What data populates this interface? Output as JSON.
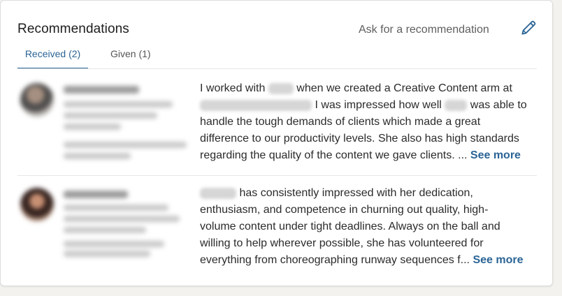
{
  "section": {
    "title": "Recommendations",
    "ask_link": "Ask for a recommendation",
    "edit_icon": "pencil-icon"
  },
  "tabs": [
    {
      "label": "Received (2)",
      "selected": true
    },
    {
      "label": "Given (1)",
      "selected": false
    }
  ],
  "recommendations": [
    {
      "text": {
        "l1a": "I worked with",
        "l1b": "when we created a Creative Content arm at",
        "l2a": "I was impressed how well",
        "l2b": "was able to",
        "l3": "handle the tough demands of clients which made a great",
        "l4": "difference to our productivity levels. She also has high standards",
        "l5": "regarding the quality of the content we gave clients. ...",
        "see_more": "See more"
      }
    },
    {
      "text": {
        "l1": "has consistently impressed with her dedication,",
        "l2": "enthusiasm, and competence in churning out quality, high-",
        "l3": "volume content under tight deadlines. Always on the ball and",
        "l4": "willing to help wherever possible, she has volunteered for",
        "l5": "everything from choreographing runway sequences f...",
        "see_more": "See more"
      }
    }
  ],
  "colors": {
    "accent": "#2a6496",
    "text": "#2b2b2b",
    "muted": "#5e5e5e",
    "background": "#f3f2ef",
    "card": "#ffffff"
  }
}
